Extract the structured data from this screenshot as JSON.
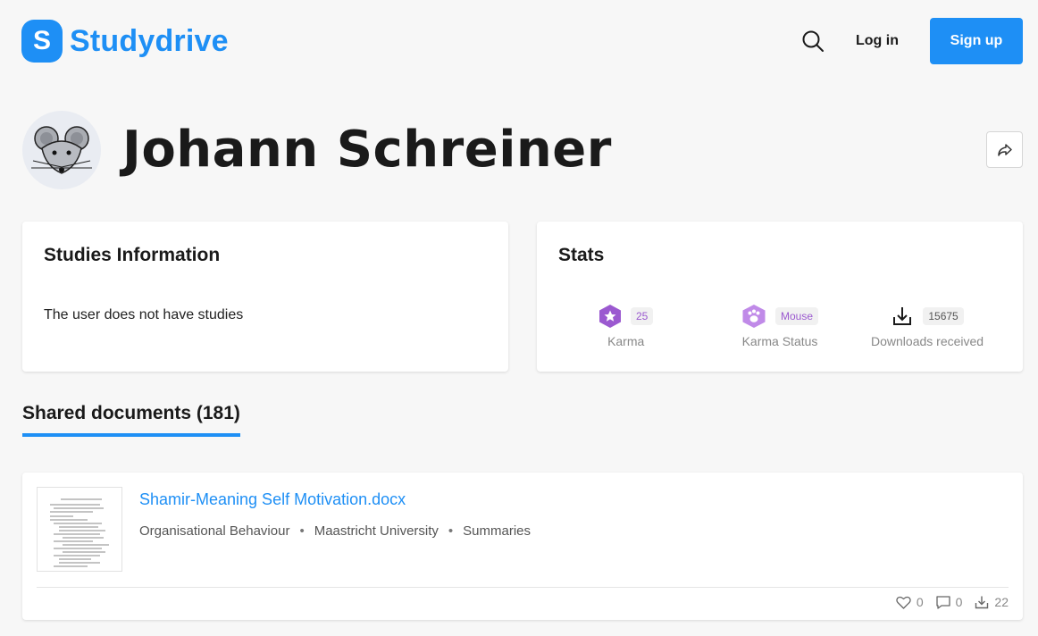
{
  "header": {
    "logo_letter": "S",
    "logo_text": "Studydrive",
    "login_label": "Log in",
    "signup_label": "Sign up"
  },
  "profile": {
    "name": "Johann Schreiner"
  },
  "studies": {
    "title": "Studies Information",
    "empty_text": "The user does not have studies"
  },
  "stats": {
    "title": "Stats",
    "karma": {
      "value": "25",
      "label": "Karma"
    },
    "karma_status": {
      "value": "Mouse",
      "label": "Karma Status"
    },
    "downloads": {
      "value": "15675",
      "label": "Downloads received"
    }
  },
  "tabs": {
    "shared_documents": "Shared documents (181)"
  },
  "documents": [
    {
      "title": "Shamir-Meaning Self Motivation.docx",
      "course": "Organisational Behaviour",
      "separator": "•",
      "university": "Maastricht University",
      "type": "Summaries",
      "likes": "0",
      "comments": "0",
      "downloads": "22"
    }
  ],
  "colors": {
    "brand": "#1e8ff5",
    "karma_purple": "#9b59d0"
  },
  "icons": {
    "search": "search-icon",
    "share": "share-icon",
    "karma": "star-badge-icon",
    "status": "paw-badge-icon",
    "downloads": "download-icon",
    "like": "heart-icon",
    "comment": "comment-icon",
    "doc_download": "download-icon"
  }
}
